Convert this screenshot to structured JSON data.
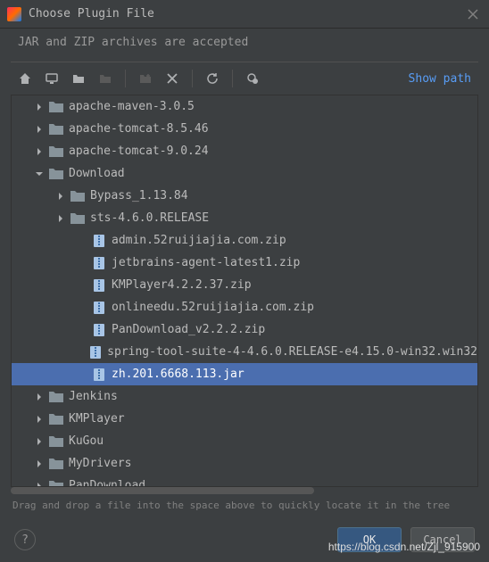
{
  "window": {
    "title": "Choose Plugin File",
    "subtitle": "JAR and ZIP archives are accepted"
  },
  "toolbar": {
    "show_path_label": "Show path"
  },
  "tree": {
    "items": [
      {
        "indent": 0,
        "arrow": "right",
        "icon": "folder",
        "label": "apache-maven-3.0.5",
        "selected": false
      },
      {
        "indent": 0,
        "arrow": "right",
        "icon": "folder",
        "label": "apache-tomcat-8.5.46",
        "selected": false
      },
      {
        "indent": 0,
        "arrow": "right",
        "icon": "folder",
        "label": "apache-tomcat-9.0.24",
        "selected": false
      },
      {
        "indent": 0,
        "arrow": "down",
        "icon": "folder",
        "label": "Download",
        "selected": false
      },
      {
        "indent": 1,
        "arrow": "right",
        "icon": "folder",
        "label": "Bypass_1.13.84",
        "selected": false
      },
      {
        "indent": 1,
        "arrow": "right",
        "icon": "folder",
        "label": "sts-4.6.0.RELEASE",
        "selected": false
      },
      {
        "indent": 1,
        "arrow": "none",
        "icon": "archive",
        "label": "admin.52ruijiajia.com.zip",
        "selected": false
      },
      {
        "indent": 1,
        "arrow": "none",
        "icon": "archive",
        "label": "jetbrains-agent-latest1.zip",
        "selected": false
      },
      {
        "indent": 1,
        "arrow": "none",
        "icon": "archive",
        "label": "KMPlayer4.2.2.37.zip",
        "selected": false
      },
      {
        "indent": 1,
        "arrow": "none",
        "icon": "archive",
        "label": "onlineedu.52ruijiajia.com.zip",
        "selected": false
      },
      {
        "indent": 1,
        "arrow": "none",
        "icon": "archive",
        "label": "PanDownload_v2.2.2.zip",
        "selected": false
      },
      {
        "indent": 1,
        "arrow": "none",
        "icon": "archive",
        "label": "spring-tool-suite-4-4.6.0.RELEASE-e4.15.0-win32.win32",
        "selected": false
      },
      {
        "indent": 1,
        "arrow": "none",
        "icon": "archive",
        "label": "zh.201.6668.113.jar",
        "selected": true
      },
      {
        "indent": 0,
        "arrow": "right",
        "icon": "folder",
        "label": "Jenkins",
        "selected": false
      },
      {
        "indent": 0,
        "arrow": "right",
        "icon": "folder",
        "label": "KMPlayer",
        "selected": false
      },
      {
        "indent": 0,
        "arrow": "right",
        "icon": "folder",
        "label": "KuGou",
        "selected": false
      },
      {
        "indent": 0,
        "arrow": "right",
        "icon": "folder",
        "label": "MyDrivers",
        "selected": false
      },
      {
        "indent": 0,
        "arrow": "right",
        "icon": "folder",
        "label": "PanDownload",
        "selected": false
      }
    ]
  },
  "hint": "Drag and drop a file into the space above to quickly locate it in the tree",
  "buttons": {
    "ok": "OK",
    "cancel": "Cancel",
    "help": "?"
  },
  "watermark": "https://blog.csdn.net/Zjl_915900"
}
